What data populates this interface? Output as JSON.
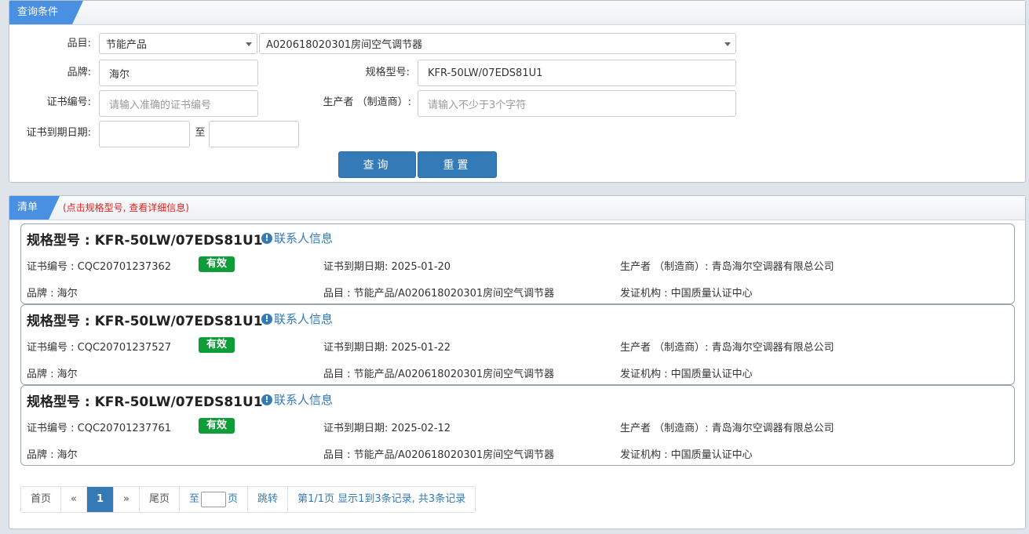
{
  "search": {
    "tab_title": "查询条件",
    "category_label": "品目:",
    "category_value": "节能产品",
    "subcategory_value": "A020618020301房间空气调节器",
    "brand_label": "品牌:",
    "brand_value": "海尔",
    "model_label": "规格型号:",
    "model_value": "KFR-50LW/07EDS81U1",
    "cert_no_label": "证书编号:",
    "cert_no_placeholder": "请输入准确的证书编号",
    "maker_label": "生产者 （制造商）:",
    "maker_placeholder": "请输入不少于3个字符",
    "expiry_label": "证书到期日期:",
    "to_label": "至",
    "query_button": "查询",
    "reset_button": "重置"
  },
  "list": {
    "tab_title": "清单",
    "hint": "(点击规格型号, 查看详细信息)",
    "items": [
      {
        "model": "规格型号 : KFR-50LW/07EDS81U1",
        "contact": "联系人信息",
        "cert_no": "证书编号 : CQC20701237362",
        "status": "有效",
        "expiry": "证书到期日期: 2025-01-20",
        "maker": "生产者 （制造商）: 青岛海尔空调器有限总公司",
        "brand": "品牌 : 海尔",
        "category": "品目 : 节能产品/A020618020301房间空气调节器",
        "issuer": "发证机构 : 中国质量认证中心"
      },
      {
        "model": "规格型号 : KFR-50LW/07EDS81U1",
        "contact": "联系人信息",
        "cert_no": "证书编号 : CQC20701237527",
        "status": "有效",
        "expiry": "证书到期日期: 2025-01-22",
        "maker": "生产者 （制造商）: 青岛海尔空调器有限总公司",
        "brand": "品牌 : 海尔",
        "category": "品目 : 节能产品/A020618020301房间空气调节器",
        "issuer": "发证机构 : 中国质量认证中心"
      },
      {
        "model": "规格型号 : KFR-50LW/07EDS81U1",
        "contact": "联系人信息",
        "cert_no": "证书编号 : CQC20701237761",
        "status": "有效",
        "expiry": "证书到期日期: 2025-02-12",
        "maker": "生产者 （制造商）: 青岛海尔空调器有限总公司",
        "brand": "品牌 : 海尔",
        "category": "品目 : 节能产品/A020618020301房间空气调节器",
        "issuer": "发证机构 : 中国质量认证中心"
      }
    ]
  },
  "pager": {
    "first": "首页",
    "prev": "«",
    "current": "1",
    "next": "»",
    "last": "尾页",
    "goto_prefix": "至",
    "goto_suffix": "页",
    "jump": "跳转",
    "summary": "第1/1页  显示1到3条记录, 共3条记录"
  },
  "colors": {
    "accent": "#337ab7",
    "tab": "#4a90e2",
    "valid_badge": "#0f9d3a",
    "hint": "#e02020"
  }
}
